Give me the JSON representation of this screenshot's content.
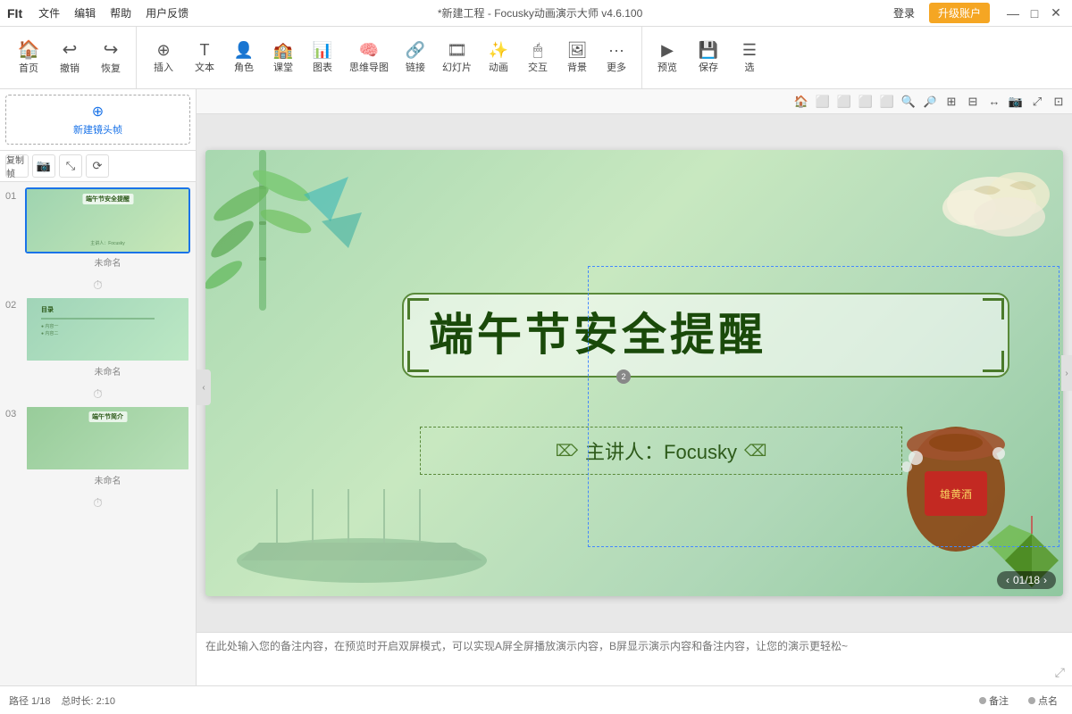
{
  "titlebar": {
    "logo": "F",
    "logo_full": "FIt",
    "menu_items": [
      "文件",
      "编辑",
      "帮助",
      "用户反馈"
    ],
    "title": "*新建工程 - Focusky动画演示大师 v4.6.100",
    "login_label": "登录",
    "upgrade_label": "升级账户",
    "win_minimize": "—",
    "win_maximize": "□",
    "win_close": "✕"
  },
  "toolbar": {
    "groups": [
      {
        "items": [
          {
            "icon": "🏠",
            "label": "首页"
          },
          {
            "icon": "↩",
            "label": "撤销"
          },
          {
            "icon": "↪",
            "label": "恢复"
          }
        ]
      },
      {
        "items": [
          {
            "icon": "⊕",
            "label": "插入"
          },
          {
            "icon": "T",
            "label": "文本"
          },
          {
            "icon": "👤",
            "label": "角色"
          },
          {
            "icon": "🏫",
            "label": "课堂"
          },
          {
            "icon": "📊",
            "label": "图表"
          },
          {
            "icon": "🧠",
            "label": "思维导图"
          },
          {
            "icon": "🔗",
            "label": "链接"
          },
          {
            "icon": "🎞",
            "label": "幻灯片"
          },
          {
            "icon": "✨",
            "label": "动画"
          },
          {
            "icon": "🖱",
            "label": "交互"
          },
          {
            "icon": "🖼",
            "label": "背景"
          },
          {
            "icon": "⋯",
            "label": "更多"
          }
        ]
      },
      {
        "items": [
          {
            "icon": "▶",
            "label": "预览"
          },
          {
            "icon": "💾",
            "label": "保存"
          },
          {
            "icon": "☰",
            "label": "选"
          }
        ]
      }
    ]
  },
  "sidebar": {
    "new_frame_label": "新建镜头帧",
    "tools": [
      "复制帧",
      "📷",
      "⤡",
      "⟳"
    ],
    "slides": [
      {
        "num": "01",
        "name": "未命名",
        "title": "端午节安全提醒",
        "active": true
      },
      {
        "num": "02",
        "name": "未命名",
        "title": "目录"
      },
      {
        "num": "03",
        "name": "未命名",
        "title": "端午节简介"
      }
    ]
  },
  "canvas": {
    "tools": [
      "🏠",
      "□",
      "□",
      "□",
      "□",
      "🔍+",
      "🔍-",
      "⊞",
      "⊟",
      "↔",
      "📷",
      "⤢",
      "⊡"
    ],
    "slide_title": "端午节安全提醒",
    "slide_subtitle": "主讲人：Focusky",
    "counter": "01/18"
  },
  "notes": {
    "placeholder": "在此处输入您的备注内容，在预览时开启双屏模式，可以实现A屏全屏播放演示内容，B屏显示演示内容和备注内容，让您的演示更轻松~"
  },
  "statusbar": {
    "page_info": "路径 1/18",
    "duration": "总时长: 2:10",
    "note_label": "备注",
    "point_label": "点名"
  }
}
